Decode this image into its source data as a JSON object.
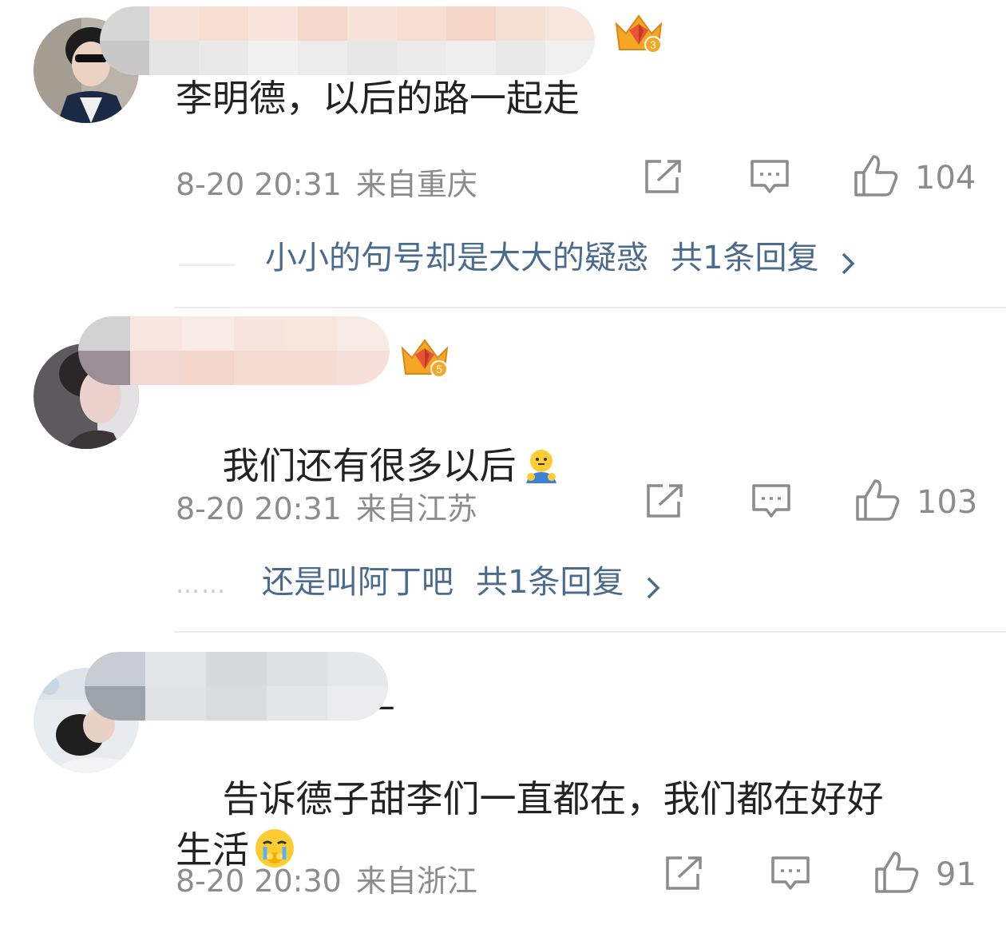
{
  "comments": [
    {
      "text": "李明德，以后的路一起走",
      "time": "8-20 20:31",
      "location": "来自重庆",
      "likes": "104",
      "badge_level": "3",
      "reply": {
        "preview": "小小的句号却是大大的疑惑",
        "count_label": "共1条回复"
      }
    },
    {
      "text": "我们还有很多以后",
      "emoji": "shy-face-emoji",
      "time": "8-20 20:31",
      "location": "来自江苏",
      "likes": "103",
      "badge_level": "5",
      "reply": {
        "dots": "……",
        "preview": "还是叫阿丁吧",
        "count_label": "共1条回复"
      }
    },
    {
      "text": "告诉德子甜李们一直都在，我们都在好好\n生活",
      "emoji": "crying-face-emoji",
      "time": "8-20 20:30",
      "location": "来自浙江",
      "likes": "91",
      "name_fragment": "d_"
    }
  ],
  "icons": {
    "share": "share-icon",
    "comment": "comment-icon",
    "like": "thumbs-up-icon",
    "badge": "crown-badge-icon",
    "chevron": "chevron-right-icon"
  },
  "colors": {
    "text": "#222222",
    "meta": "#8c8c8c",
    "reply_link": "#4a6a8e",
    "badge_gold": "#f5a623",
    "badge_red": "#e8543a"
  }
}
